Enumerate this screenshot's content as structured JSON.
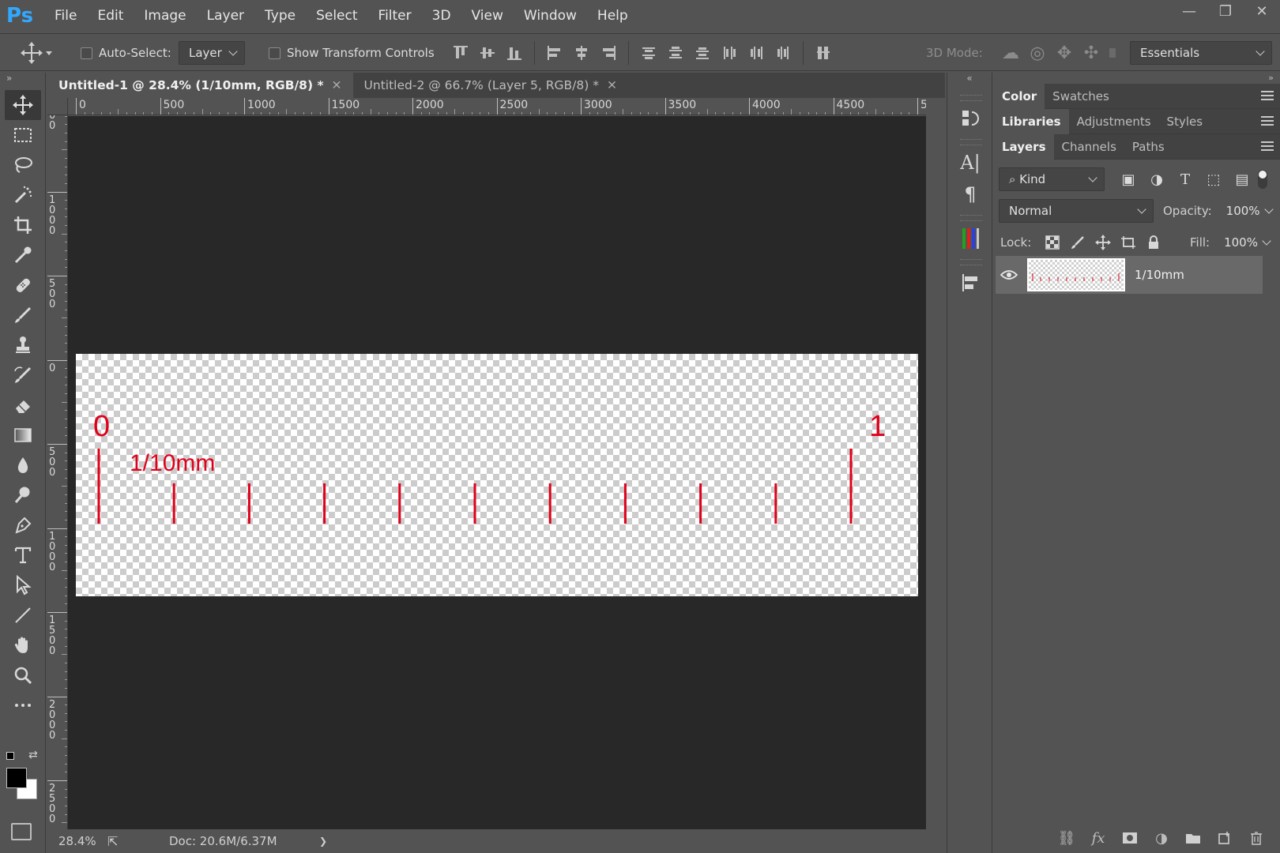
{
  "app": {
    "logo": "Ps"
  },
  "menu": [
    "File",
    "Edit",
    "Image",
    "Layer",
    "Type",
    "Select",
    "Filter",
    "3D",
    "View",
    "Window",
    "Help"
  ],
  "window_controls": {
    "minimize": "—",
    "restore": "❐",
    "close": "✕"
  },
  "options_bar": {
    "auto_select_label": "Auto-Select:",
    "auto_select_target": "Layer",
    "show_transform_label": "Show Transform Controls",
    "mode_3d_label": "3D Mode:",
    "workspace": "Essentials"
  },
  "tabs": [
    {
      "label": "Untitled-1 @ 28.4% (1/10mm, RGB/8) *",
      "close": "✕",
      "active": true
    },
    {
      "label": "Untitled-2 @ 66.7% (Layer 5, RGB/8) *",
      "close": "✕",
      "active": false
    }
  ],
  "rulers": {
    "horizontal_labels": [
      "0",
      "500",
      "1000",
      "1500",
      "2000",
      "2500",
      "3000",
      "3500",
      "4000",
      "4500",
      "5"
    ],
    "vertical_labels": [
      "0\n0",
      "1\n0\n0\n0",
      "5\n0\n0",
      "0",
      "5\n0\n0",
      "1\n0\n0\n0",
      "1\n5\n0\n0",
      "2\n0\n0\n0",
      "2\n5\n0\n0"
    ]
  },
  "canvas": {
    "label_zero": "0",
    "label_one": "1",
    "unit_label": "1/10mm",
    "tick_color": "#e0001a",
    "minor_tick_count": 9
  },
  "status": {
    "zoom": "28.4%",
    "doc_info": "Doc: 20.6M/6.37M",
    "arrow": "❯"
  },
  "panels": {
    "group1_tabs": [
      "Color",
      "Swatches"
    ],
    "group2_tabs": [
      "Libraries",
      "Adjustments",
      "Styles"
    ],
    "group3_tabs": [
      "Layers",
      "Channels",
      "Paths"
    ],
    "filter_kind": "Kind",
    "blend_mode": "Normal",
    "opacity_label": "Opacity:",
    "opacity_value": "100%",
    "lock_label": "Lock:",
    "fill_label": "Fill:",
    "fill_value": "100%",
    "layer": {
      "name": "1/10mm",
      "visible": true
    }
  },
  "colors": {
    "accent_ps": "#31a8ff",
    "foreground": "#000000",
    "background": "#ffffff"
  }
}
